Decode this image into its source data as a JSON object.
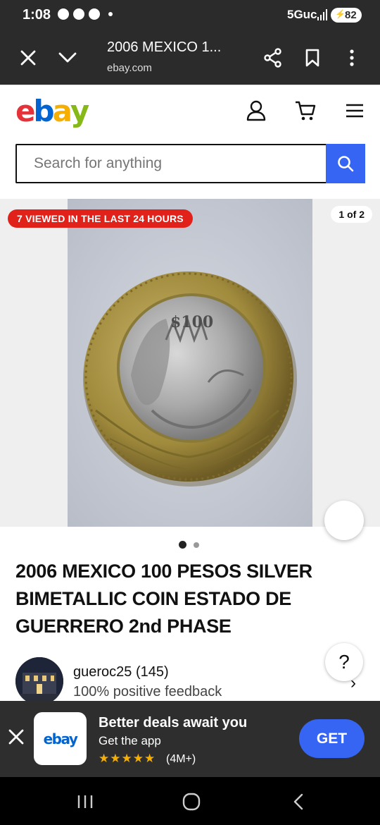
{
  "status_bar": {
    "time": "1:08",
    "network": "5Guc",
    "battery": "82"
  },
  "browser": {
    "page_title": "2006 MEXICO 1...",
    "domain": "ebay.com"
  },
  "header": {
    "logo_letters": [
      "e",
      "b",
      "a",
      "y"
    ],
    "logo_colors": [
      "#e53238",
      "#0064d2",
      "#f5af02",
      "#86b817"
    ]
  },
  "search": {
    "placeholder": "Search for anything"
  },
  "gallery": {
    "viewed_badge": "7 VIEWED IN THE LAST 24 HOURS",
    "page_indicator": "1 of 2",
    "coin_text": "$100"
  },
  "listing": {
    "title": "2006 MEXICO 100 PESOS SILVER BIMETALLIC COIN ESTADO DE GUERRERO 2nd PHASE"
  },
  "seller": {
    "name": "gueroc25 (145)",
    "feedback": "100% positive feedback"
  },
  "help": {
    "label": "?"
  },
  "app_banner": {
    "logo_text": "ebay",
    "headline": "Better deals await you",
    "subtitle": "Get the app",
    "stars": "★★★★★",
    "review_count": "(4M+)",
    "cta": "GET"
  },
  "colors": {
    "accent": "#3665f3",
    "badge_red": "#e0221a",
    "star_gold": "#f5af02"
  }
}
